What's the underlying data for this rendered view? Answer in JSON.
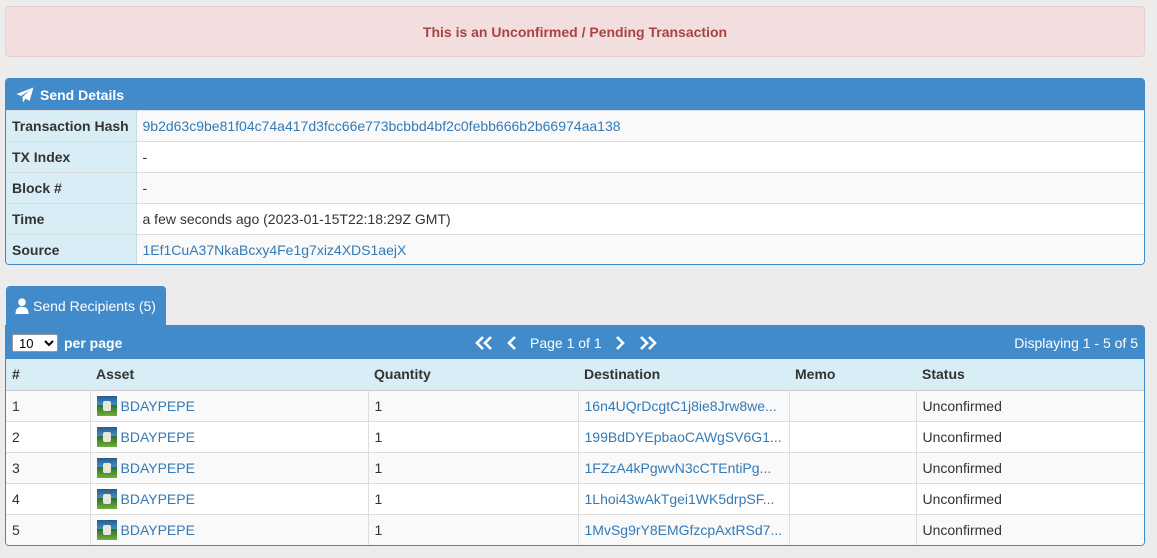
{
  "alert": {
    "text": "This is an Unconfirmed / Pending Transaction"
  },
  "send_details": {
    "title": "Send Details",
    "rows": [
      {
        "label": "Transaction Hash",
        "value": "9b2d63c9be81f04c74a417d3fcc66e773bcbbd4bf2c0febb666b2b66974aa138",
        "link": true
      },
      {
        "label": "TX Index",
        "value": "-",
        "link": false
      },
      {
        "label": "Block #",
        "value": "-",
        "link": false
      },
      {
        "label": "Time",
        "value": "a few seconds ago (2023-01-15T22:18:29Z GMT)",
        "link": false
      },
      {
        "label": "Source",
        "value": "1Ef1CuA37NkaBcxy4Fe1g7xiz4XDS1aejX",
        "link": true
      }
    ]
  },
  "recipients": {
    "tab_label": "Send Recipients (5)",
    "per_page_value": "10",
    "per_page_label": "per page",
    "page_text": "Page 1 of 1",
    "displaying": "Displaying 1 - 5 of 5",
    "columns": [
      "#",
      "Asset",
      "Quantity",
      "Destination",
      "Memo",
      "Status"
    ],
    "rows": [
      {
        "num": "1",
        "asset": "BDAYPEPE",
        "quantity": "1",
        "destination": "16n4UQrDcgtC1j8ie8Jrw8we...",
        "memo": "",
        "status": "Unconfirmed"
      },
      {
        "num": "2",
        "asset": "BDAYPEPE",
        "quantity": "1",
        "destination": "199BdDYEpbaoCAWgSV6G1...",
        "memo": "",
        "status": "Unconfirmed"
      },
      {
        "num": "3",
        "asset": "BDAYPEPE",
        "quantity": "1",
        "destination": "1FZzA4kPgwvN3cCTEntiPg...",
        "memo": "",
        "status": "Unconfirmed"
      },
      {
        "num": "4",
        "asset": "BDAYPEPE",
        "quantity": "1",
        "destination": "1Lhoi43wAkTgei1WK5drpSF...",
        "memo": "",
        "status": "Unconfirmed"
      },
      {
        "num": "5",
        "asset": "BDAYPEPE",
        "quantity": "1",
        "destination": "1MvSg9rY8EMGfzcpAxtRSd7...",
        "memo": "",
        "status": "Unconfirmed"
      }
    ]
  },
  "icons": {
    "send": "paper-plane-icon",
    "recipients": "user-icon"
  },
  "colors": {
    "primary": "#428bca",
    "alert_text": "#a94442",
    "alert_bg": "#f2dede",
    "link": "#337ab7",
    "header_cell": "#d9edf7"
  }
}
